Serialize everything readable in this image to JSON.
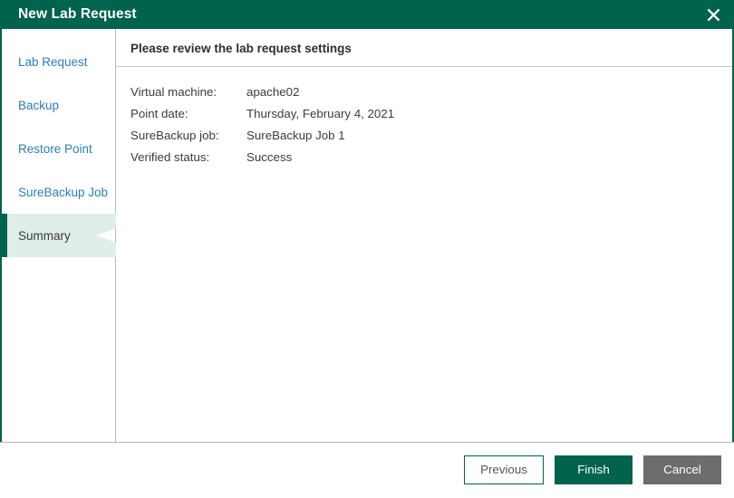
{
  "window": {
    "title": "New Lab Request",
    "close_icon": "close-icon",
    "accent_color": "#00634b",
    "active_nav_bg": "#dfeee7",
    "nav_link_color": "#2a7fba",
    "cancel_color": "#6d6d6d"
  },
  "sidebar": {
    "items": [
      {
        "label": "Lab Request",
        "active": false
      },
      {
        "label": "Backup",
        "active": false
      },
      {
        "label": "Restore Point",
        "active": false
      },
      {
        "label": "SureBackup Job",
        "active": false
      },
      {
        "label": "Summary",
        "active": true
      }
    ]
  },
  "content": {
    "header": "Please review the lab request settings",
    "fields": [
      {
        "label": "Virtual machine:",
        "value": "apache02"
      },
      {
        "label": "Point date:",
        "value": "Thursday, February 4, 2021"
      },
      {
        "label": "SureBackup job:",
        "value": "SureBackup Job 1"
      },
      {
        "label": "Verified status:",
        "value": "Success"
      }
    ]
  },
  "footer": {
    "previous_label": "Previous",
    "finish_label": "Finish",
    "cancel_label": "Cancel"
  }
}
